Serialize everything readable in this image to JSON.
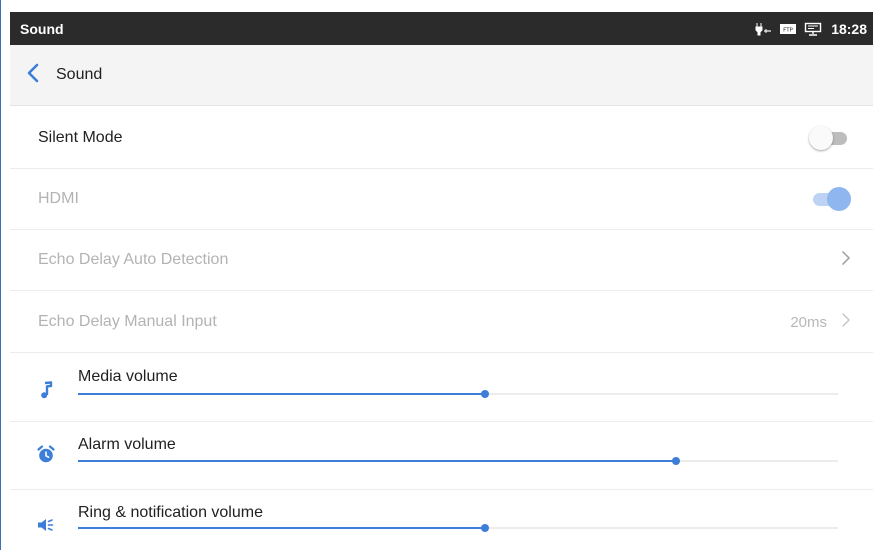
{
  "statusbar": {
    "title": "Sound",
    "time": "18:28",
    "icons": [
      "usb-debug-icon",
      "ftp-icon",
      "ethernet-icon"
    ]
  },
  "header": {
    "back_icon": "chevron-left-icon",
    "title": "Sound"
  },
  "colors": {
    "accent": "#3d7ed8",
    "statusbar_bg": "#2b2b2b",
    "header_bg": "#f4f4f4",
    "disabled_text": "#b3b3b3"
  },
  "settings": {
    "silent_mode": {
      "label": "Silent Mode",
      "enabled": false
    },
    "hdmi": {
      "label": "HDMI",
      "enabled": true
    },
    "echo_auto": {
      "label": "Echo Delay Auto Detection"
    },
    "echo_manual": {
      "label": "Echo Delay Manual Input",
      "value": "20ms"
    }
  },
  "volumes": {
    "media": {
      "label": "Media volume",
      "icon": "music-note-icon",
      "level": 0.535
    },
    "alarm": {
      "label": "Alarm volume",
      "icon": "alarm-clock-icon",
      "level": 0.787
    },
    "ring": {
      "label": "Ring & notification volume",
      "icon": "speaker-icon",
      "level": 0.535
    }
  }
}
